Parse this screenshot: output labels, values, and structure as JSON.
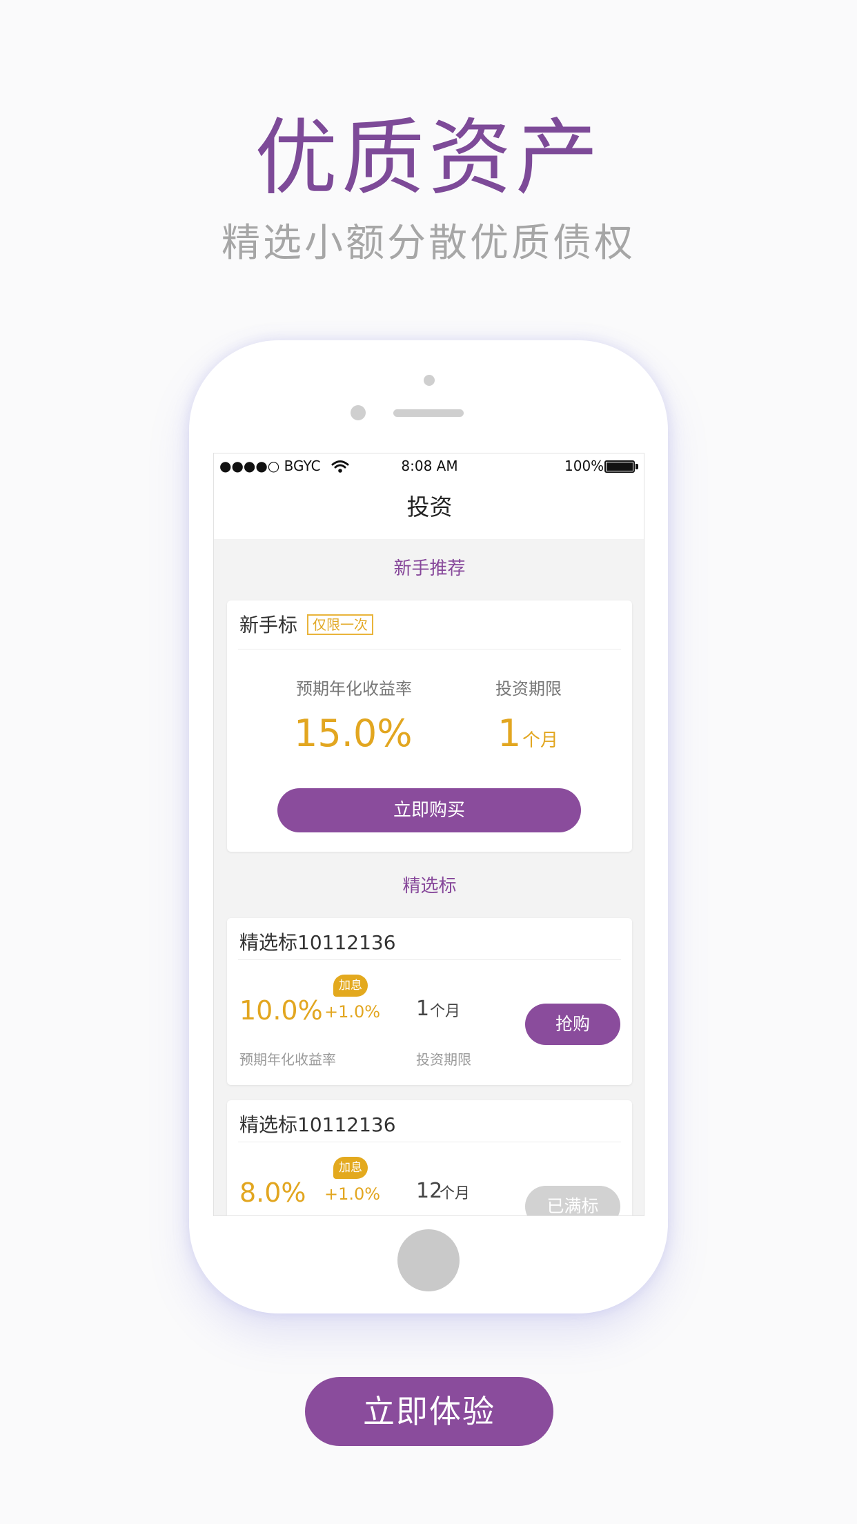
{
  "hero": {
    "title": "优质资产",
    "subtitle": "精选小额分散优质债权"
  },
  "status_bar": {
    "carrier": "●●●●○ BGYC",
    "time": "8:08 AM",
    "battery": "100%"
  },
  "nav": {
    "title": "投资"
  },
  "newbie": {
    "section_title": "新手推荐",
    "card_title": "新手标",
    "tag": "仅限一次",
    "rate_label": "预期年化收益率",
    "period_label": "投资期限",
    "rate": "15.0%",
    "period_value": "1",
    "period_unit": "个月",
    "buy_button": "立即购买"
  },
  "selected": {
    "section_title": "精选标",
    "items": [
      {
        "title": "精选标10112136",
        "rate": "10.0%",
        "bonus_tag": "加息",
        "bonus_rate": "+1.0%",
        "period_value": "1",
        "period_unit": "个月",
        "rate_label": "预期年化收益率",
        "period_label": "投资期限",
        "button": "抢购"
      },
      {
        "title": "精选标10112136",
        "rate": "8.0%",
        "bonus_tag": "加息",
        "bonus_rate": "+1.0%",
        "period_value": "12",
        "period_unit": "个月",
        "button": "已满标"
      }
    ]
  },
  "cta": {
    "label": "立即体验"
  },
  "colors": {
    "brand_purple": "#8a4c9c",
    "accent_orange": "#e2a620",
    "background": "#fafafb"
  }
}
